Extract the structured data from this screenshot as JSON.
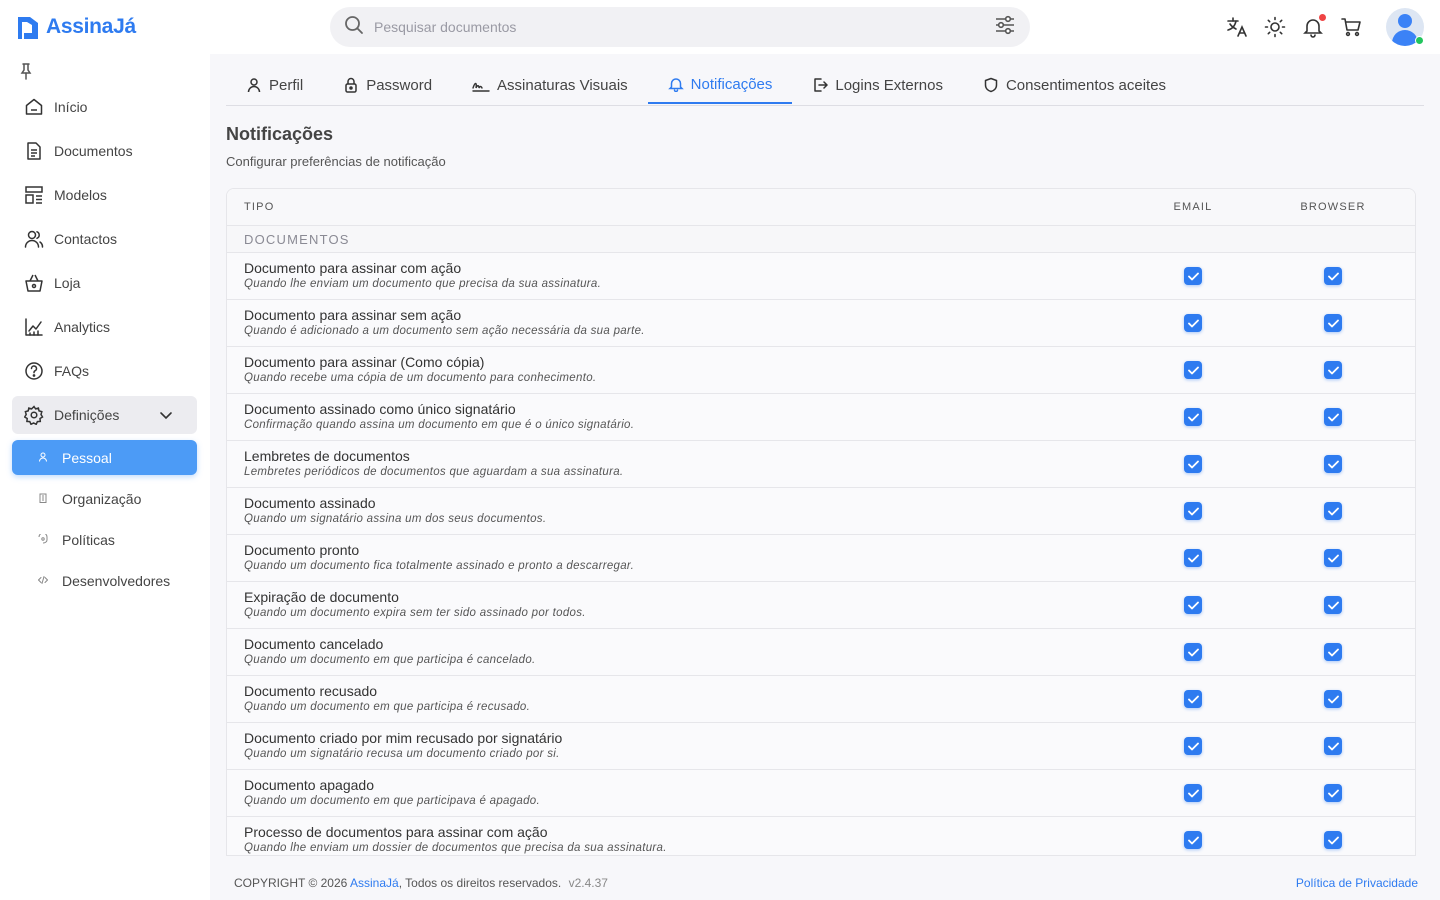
{
  "app": {
    "name": "AssinaJá"
  },
  "header": {
    "search_placeholder": "Pesquisar documentos"
  },
  "sidebar": {
    "items": [
      {
        "label": "Início",
        "icon": "home-icon"
      },
      {
        "label": "Documentos",
        "icon": "document-icon"
      },
      {
        "label": "Modelos",
        "icon": "template-icon"
      },
      {
        "label": "Contactos",
        "icon": "contacts-icon"
      },
      {
        "label": "Loja",
        "icon": "basket-icon"
      },
      {
        "label": "Analytics",
        "icon": "chart-icon"
      },
      {
        "label": "FAQs",
        "icon": "help-icon"
      }
    ],
    "group": {
      "label": "Definições",
      "icon": "gear-icon"
    },
    "sub_items": [
      {
        "label": "Pessoal",
        "active": true
      },
      {
        "label": "Organização"
      },
      {
        "label": "Políticas"
      },
      {
        "label": "Desenvolvedores"
      }
    ]
  },
  "tabs": [
    {
      "label": "Perfil",
      "icon": "user-icon"
    },
    {
      "label": "Password",
      "icon": "lock-icon"
    },
    {
      "label": "Assinaturas Visuais",
      "icon": "signature-icon"
    },
    {
      "label": "Notificações",
      "icon": "bell-icon",
      "active": true
    },
    {
      "label": "Logins Externos",
      "icon": "login-icon"
    },
    {
      "label": "Consentimentos aceites",
      "icon": "shield-icon"
    }
  ],
  "section": {
    "title": "Notificações",
    "subtitle": "Configurar preferências de notificação"
  },
  "table": {
    "headers": {
      "type": "TIPO",
      "email": "EMAIL",
      "browser": "BROWSER"
    },
    "group": "DOCUMENTOS",
    "rows": [
      {
        "title": "Documento para assinar com ação",
        "desc": "Quando lhe enviam um documento que precisa da sua assinatura.",
        "email": true,
        "browser": true
      },
      {
        "title": "Documento para assinar sem ação",
        "desc": "Quando é adicionado a um documento sem ação necessária da sua parte.",
        "email": true,
        "browser": true
      },
      {
        "title": "Documento para assinar (Como cópia)",
        "desc": "Quando recebe uma cópia de um documento para conhecimento.",
        "email": true,
        "browser": true
      },
      {
        "title": "Documento assinado como único signatário",
        "desc": "Confirmação quando assina um documento em que é o único signatário.",
        "email": true,
        "browser": true
      },
      {
        "title": "Lembretes de documentos",
        "desc": "Lembretes periódicos de documentos que aguardam a sua assinatura.",
        "email": true,
        "browser": true
      },
      {
        "title": "Documento assinado",
        "desc": "Quando um signatário assina um dos seus documentos.",
        "email": true,
        "browser": true
      },
      {
        "title": "Documento pronto",
        "desc": "Quando um documento fica totalmente assinado e pronto a descarregar.",
        "email": true,
        "browser": true
      },
      {
        "title": "Expiração de documento",
        "desc": "Quando um documento expira sem ter sido assinado por todos.",
        "email": true,
        "browser": true
      },
      {
        "title": "Documento cancelado",
        "desc": "Quando um documento em que participa é cancelado.",
        "email": true,
        "browser": true
      },
      {
        "title": "Documento recusado",
        "desc": "Quando um documento em que participa é recusado.",
        "email": true,
        "browser": true
      },
      {
        "title": "Documento criado por mim recusado por signatário",
        "desc": "Quando um signatário recusa um documento criado por si.",
        "email": true,
        "browser": true
      },
      {
        "title": "Documento apagado",
        "desc": "Quando um documento em que participava é apagado.",
        "email": true,
        "browser": true
      },
      {
        "title": "Processo de documentos para assinar com ação",
        "desc": "Quando lhe enviam um dossier de documentos que precisa da sua assinatura.",
        "email": true,
        "browser": true
      }
    ]
  },
  "footer": {
    "copyright": "COPYRIGHT © 2026",
    "brand": "AssinaJá",
    "rights": ", Todos os direitos reservados.",
    "version": "v2.4.37",
    "privacy": "Política de Privacidade"
  },
  "colors": {
    "accent": "#2e7bf0",
    "active_item": "#4c9bf6",
    "notification_dot": "#ef4444",
    "online": "#22c55e"
  }
}
